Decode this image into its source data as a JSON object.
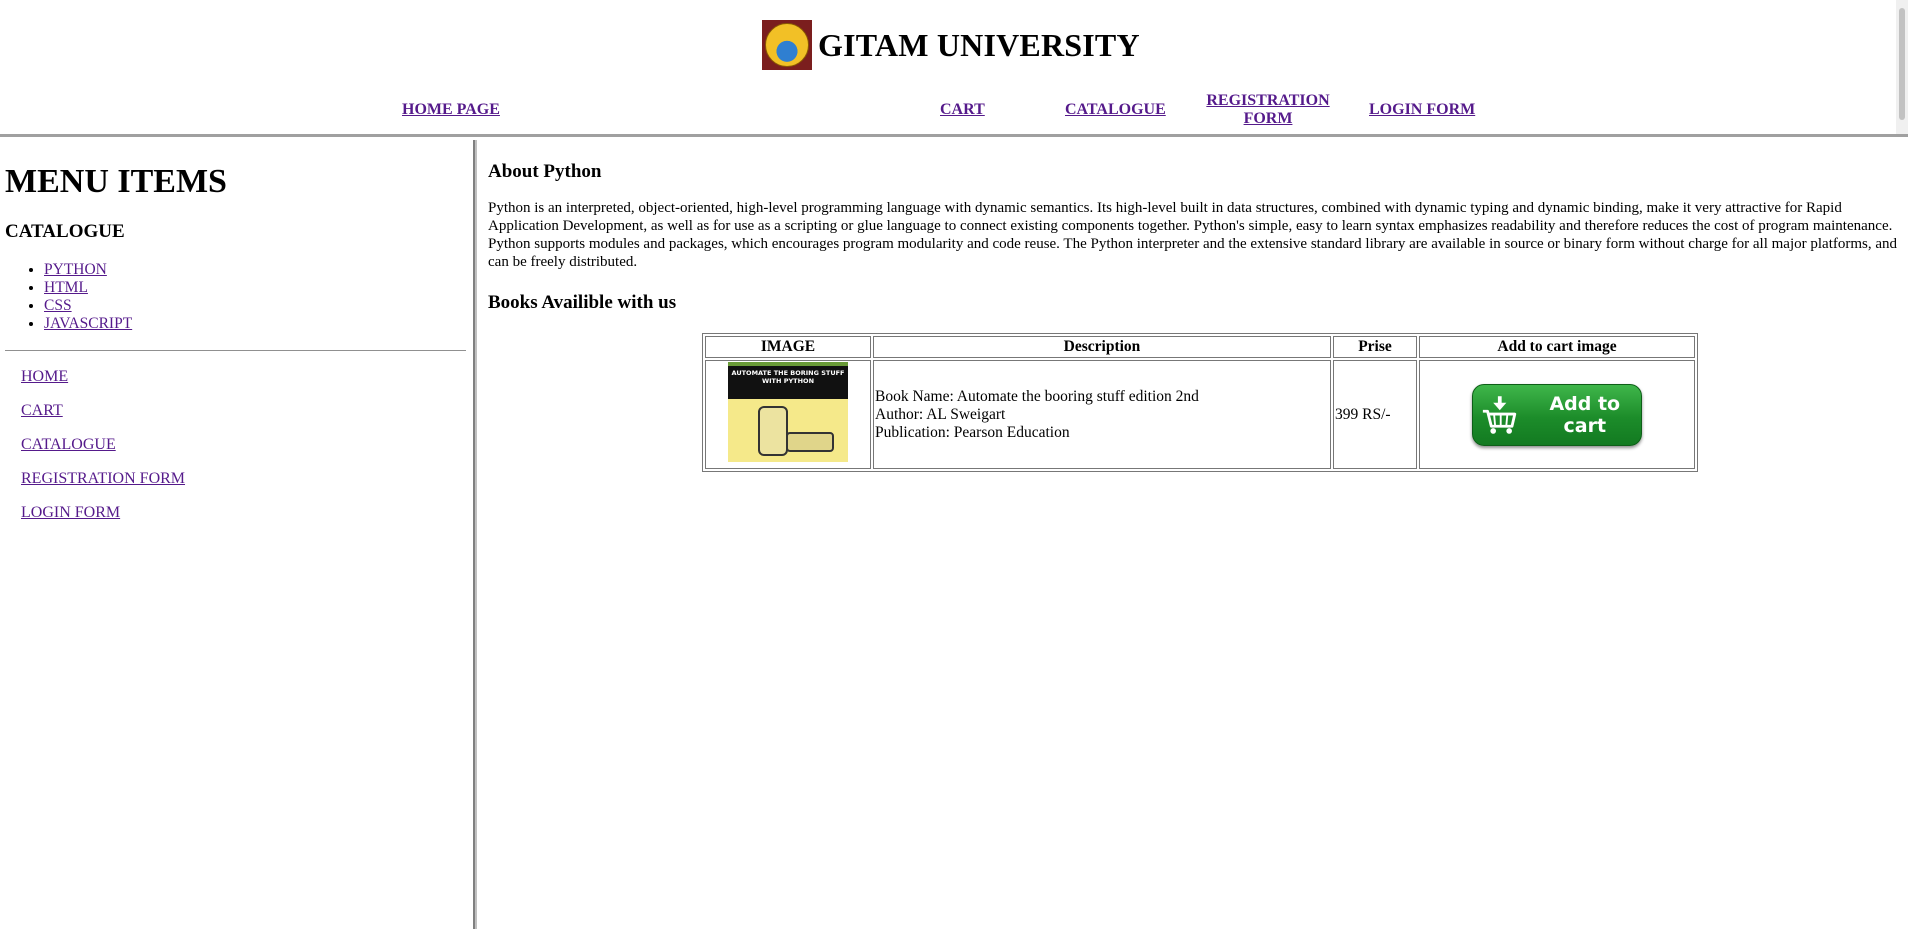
{
  "header": {
    "brand": "GITAM UNIVERSITY",
    "nav": [
      {
        "label": "HOME PAGE"
      },
      {
        "label": "CART"
      },
      {
        "label": "CATALOGUE"
      },
      {
        "label": "REGISTRATION FORM"
      },
      {
        "label": "LOGIN FORM"
      }
    ]
  },
  "sidebar": {
    "title": "MENU ITEMS",
    "catalogue_heading": "CATALOGUE",
    "catalogue_items": [
      {
        "label": "PYTHON"
      },
      {
        "label": "HTML"
      },
      {
        "label": "CSS"
      },
      {
        "label": "JAVASCRIPT"
      }
    ],
    "links": [
      {
        "label": "HOME"
      },
      {
        "label": "CART"
      },
      {
        "label": "CATALOGUE"
      },
      {
        "label": "REGISTRATION FORM"
      },
      {
        "label": "LOGIN FORM"
      }
    ]
  },
  "main": {
    "about_title": "About Python",
    "about_text": "Python is an interpreted, object-oriented, high-level programming language with dynamic semantics. Its high-level built in data structures, combined with dynamic typing and dynamic binding, make it very attractive for Rapid Application Development, as well as for use as a scripting or glue language to connect existing components together. Python's simple, easy to learn syntax emphasizes readability and therefore reduces the cost of program maintenance. Python supports modules and packages, which encourages program modularity and code reuse. The Python interpreter and the extensive standard library are available in source or binary form without charge for all major platforms, and can be freely distributed.",
    "books_title": "Books Availible with us",
    "table": {
      "headers": [
        "IMAGE",
        "Description",
        "Prise",
        "Add to cart image"
      ],
      "rows": [
        {
          "cover_text": "AUTOMATE THE BORING STUFF WITH PYTHON",
          "book_name": "Book Name: Automate the booring stuff edition 2nd",
          "author": "Author: AL Sweigart",
          "publication": "Publication: Pearson Education",
          "price": "399 RS/-",
          "cart_label": "Add to cart"
        }
      ]
    }
  },
  "colors": {
    "link": "#551a8b",
    "cart_button": "#1c8c2a",
    "logo_bg": "#7b1e1e"
  },
  "icons": [
    "gitam-logo-icon",
    "cart-icon"
  ]
}
